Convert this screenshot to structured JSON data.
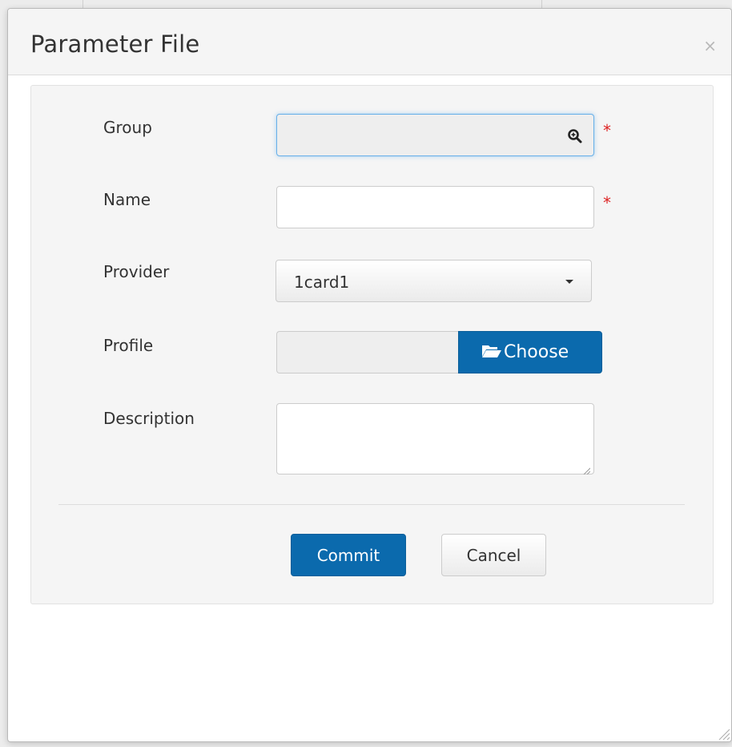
{
  "dialog": {
    "title": "Parameter File",
    "close_glyph": "×"
  },
  "form": {
    "group": {
      "label": "Group",
      "value": "",
      "required_mark": "*",
      "icon": "magnifier-icon"
    },
    "name": {
      "label": "Name",
      "value": "",
      "required_mark": "*"
    },
    "provider": {
      "label": "Provider",
      "selected": "1card1"
    },
    "profile": {
      "label": "Profile",
      "choose_label": "Choose",
      "icon": "folder-open-icon"
    },
    "description": {
      "label": "Description",
      "value": ""
    }
  },
  "actions": {
    "commit_label": "Commit",
    "cancel_label": "Cancel"
  },
  "colors": {
    "primary": "#0b6aad",
    "required": "#dd2222",
    "focus": "#66afe9"
  }
}
